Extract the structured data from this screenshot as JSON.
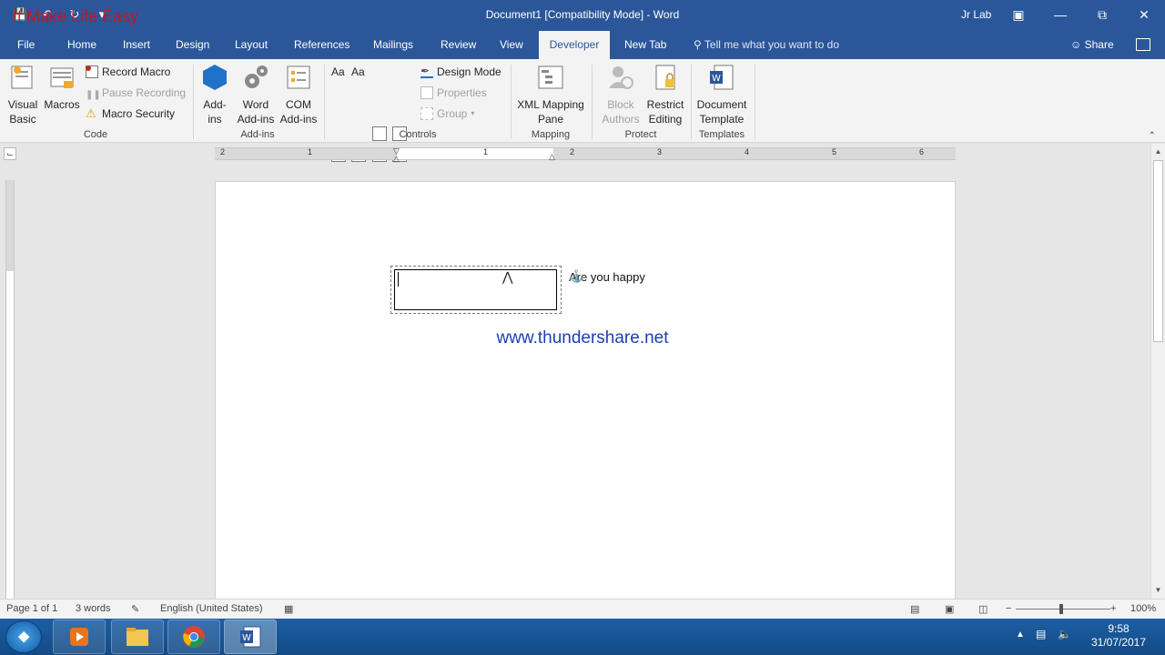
{
  "window": {
    "title": "Document1 [Compatibility Mode]  -  Word",
    "user": "Jr Lab",
    "watermark": "It Make Life Easy"
  },
  "tabs": [
    "File",
    "Home",
    "Insert",
    "Design",
    "Layout",
    "References",
    "Mailings",
    "Review",
    "View",
    "Developer",
    "New Tab"
  ],
  "active_tab": "Developer",
  "tell_me": "Tell me what you want to do",
  "share": "Share",
  "ribbon": {
    "code": {
      "label": "Code",
      "visual_basic": "Visual Basic",
      "macros": "Macros",
      "record_macro": "Record Macro",
      "pause_recording": "Pause Recording",
      "macro_security": "Macro Security"
    },
    "addins": {
      "label": "Add-ins",
      "addins": "Add-ins",
      "word_addins": "Word Add-ins",
      "com_addins": "COM Add-ins"
    },
    "controls": {
      "label": "Controls",
      "design_mode": "Design Mode",
      "properties": "Properties",
      "group": "Group"
    },
    "mapping": {
      "label": "Mapping",
      "xml_mapping_pane": "XML Mapping Pane"
    },
    "protect": {
      "label": "Protect",
      "block_authors": "Block Authors",
      "restrict_editing": "Restrict Editing"
    },
    "templates": {
      "label": "Templates",
      "document_template": "Document Template"
    }
  },
  "ruler": {
    "numbers": [
      "2",
      "1",
      "1",
      "2",
      "3",
      "4",
      "5",
      "6"
    ]
  },
  "document": {
    "label_text": "Are you happy",
    "link_text": "www.thundershare.net"
  },
  "status": {
    "page": "Page 1 of 1",
    "words": "3 words",
    "language": "English (United States)",
    "zoom": "100%"
  },
  "taskbar": {
    "time": "9:58",
    "date": "31/07/2017"
  },
  "colors": {
    "title_bar": "#2b579a",
    "link": "#1b3fb3",
    "watermark": "#d0121a"
  }
}
